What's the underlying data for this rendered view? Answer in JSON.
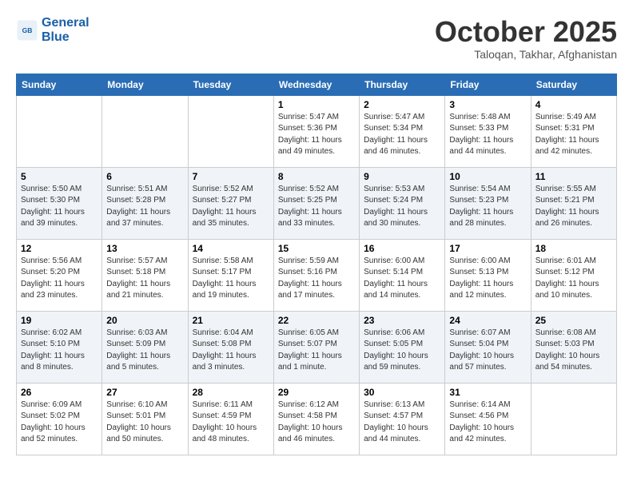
{
  "header": {
    "logo_line1": "General",
    "logo_line2": "Blue",
    "month_title": "October 2025",
    "location": "Taloqan, Takhar, Afghanistan"
  },
  "days_of_week": [
    "Sunday",
    "Monday",
    "Tuesday",
    "Wednesday",
    "Thursday",
    "Friday",
    "Saturday"
  ],
  "weeks": [
    [
      {
        "num": "",
        "info": ""
      },
      {
        "num": "",
        "info": ""
      },
      {
        "num": "",
        "info": ""
      },
      {
        "num": "1",
        "info": "Sunrise: 5:47 AM\nSunset: 5:36 PM\nDaylight: 11 hours\nand 49 minutes."
      },
      {
        "num": "2",
        "info": "Sunrise: 5:47 AM\nSunset: 5:34 PM\nDaylight: 11 hours\nand 46 minutes."
      },
      {
        "num": "3",
        "info": "Sunrise: 5:48 AM\nSunset: 5:33 PM\nDaylight: 11 hours\nand 44 minutes."
      },
      {
        "num": "4",
        "info": "Sunrise: 5:49 AM\nSunset: 5:31 PM\nDaylight: 11 hours\nand 42 minutes."
      }
    ],
    [
      {
        "num": "5",
        "info": "Sunrise: 5:50 AM\nSunset: 5:30 PM\nDaylight: 11 hours\nand 39 minutes."
      },
      {
        "num": "6",
        "info": "Sunrise: 5:51 AM\nSunset: 5:28 PM\nDaylight: 11 hours\nand 37 minutes."
      },
      {
        "num": "7",
        "info": "Sunrise: 5:52 AM\nSunset: 5:27 PM\nDaylight: 11 hours\nand 35 minutes."
      },
      {
        "num": "8",
        "info": "Sunrise: 5:52 AM\nSunset: 5:25 PM\nDaylight: 11 hours\nand 33 minutes."
      },
      {
        "num": "9",
        "info": "Sunrise: 5:53 AM\nSunset: 5:24 PM\nDaylight: 11 hours\nand 30 minutes."
      },
      {
        "num": "10",
        "info": "Sunrise: 5:54 AM\nSunset: 5:23 PM\nDaylight: 11 hours\nand 28 minutes."
      },
      {
        "num": "11",
        "info": "Sunrise: 5:55 AM\nSunset: 5:21 PM\nDaylight: 11 hours\nand 26 minutes."
      }
    ],
    [
      {
        "num": "12",
        "info": "Sunrise: 5:56 AM\nSunset: 5:20 PM\nDaylight: 11 hours\nand 23 minutes."
      },
      {
        "num": "13",
        "info": "Sunrise: 5:57 AM\nSunset: 5:18 PM\nDaylight: 11 hours\nand 21 minutes."
      },
      {
        "num": "14",
        "info": "Sunrise: 5:58 AM\nSunset: 5:17 PM\nDaylight: 11 hours\nand 19 minutes."
      },
      {
        "num": "15",
        "info": "Sunrise: 5:59 AM\nSunset: 5:16 PM\nDaylight: 11 hours\nand 17 minutes."
      },
      {
        "num": "16",
        "info": "Sunrise: 6:00 AM\nSunset: 5:14 PM\nDaylight: 11 hours\nand 14 minutes."
      },
      {
        "num": "17",
        "info": "Sunrise: 6:00 AM\nSunset: 5:13 PM\nDaylight: 11 hours\nand 12 minutes."
      },
      {
        "num": "18",
        "info": "Sunrise: 6:01 AM\nSunset: 5:12 PM\nDaylight: 11 hours\nand 10 minutes."
      }
    ],
    [
      {
        "num": "19",
        "info": "Sunrise: 6:02 AM\nSunset: 5:10 PM\nDaylight: 11 hours\nand 8 minutes."
      },
      {
        "num": "20",
        "info": "Sunrise: 6:03 AM\nSunset: 5:09 PM\nDaylight: 11 hours\nand 5 minutes."
      },
      {
        "num": "21",
        "info": "Sunrise: 6:04 AM\nSunset: 5:08 PM\nDaylight: 11 hours\nand 3 minutes."
      },
      {
        "num": "22",
        "info": "Sunrise: 6:05 AM\nSunset: 5:07 PM\nDaylight: 11 hours\nand 1 minute."
      },
      {
        "num": "23",
        "info": "Sunrise: 6:06 AM\nSunset: 5:05 PM\nDaylight: 10 hours\nand 59 minutes."
      },
      {
        "num": "24",
        "info": "Sunrise: 6:07 AM\nSunset: 5:04 PM\nDaylight: 10 hours\nand 57 minutes."
      },
      {
        "num": "25",
        "info": "Sunrise: 6:08 AM\nSunset: 5:03 PM\nDaylight: 10 hours\nand 54 minutes."
      }
    ],
    [
      {
        "num": "26",
        "info": "Sunrise: 6:09 AM\nSunset: 5:02 PM\nDaylight: 10 hours\nand 52 minutes."
      },
      {
        "num": "27",
        "info": "Sunrise: 6:10 AM\nSunset: 5:01 PM\nDaylight: 10 hours\nand 50 minutes."
      },
      {
        "num": "28",
        "info": "Sunrise: 6:11 AM\nSunset: 4:59 PM\nDaylight: 10 hours\nand 48 minutes."
      },
      {
        "num": "29",
        "info": "Sunrise: 6:12 AM\nSunset: 4:58 PM\nDaylight: 10 hours\nand 46 minutes."
      },
      {
        "num": "30",
        "info": "Sunrise: 6:13 AM\nSunset: 4:57 PM\nDaylight: 10 hours\nand 44 minutes."
      },
      {
        "num": "31",
        "info": "Sunrise: 6:14 AM\nSunset: 4:56 PM\nDaylight: 10 hours\nand 42 minutes."
      },
      {
        "num": "",
        "info": ""
      }
    ]
  ]
}
